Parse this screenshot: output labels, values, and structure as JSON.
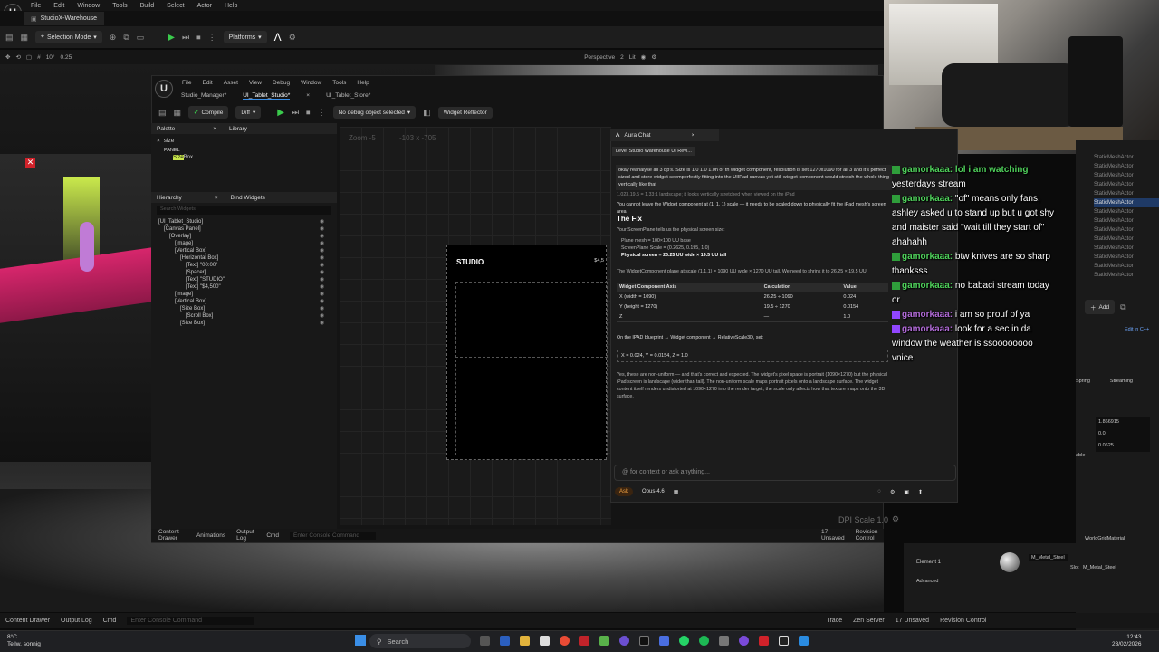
{
  "outer": {
    "menu": [
      "File",
      "Edit",
      "Window",
      "Tools",
      "Build",
      "Select",
      "Actor",
      "Help"
    ],
    "project_tab": "StudioX-Warehouse",
    "selection_mode": "Selection Mode",
    "platforms": "Platforms",
    "viewport_options": {
      "perspective": "Perspective",
      "lit": "Lit",
      "rot": "10°",
      "scale": "0.25",
      "cam": "2"
    },
    "outliner_items": [
      "StaticMeshActor",
      "StaticMeshActor",
      "StaticMeshActor",
      "StaticMeshActor",
      "StaticMeshActor",
      "StaticMeshActor",
      "StaticMeshActor",
      "StaticMeshActor",
      "StaticMeshActor",
      "StaticMeshActor",
      "StaticMeshActor",
      "StaticMeshActor",
      "StaticMeshActor",
      "StaticMeshActor"
    ],
    "details": {
      "add": "Add",
      "edit_cpp": "Edit in C++",
      "spring": "Spring",
      "streaming": "Streaming",
      "v1": "1.866915",
      "v2": "0.0",
      "v3": "0.0625",
      "table": "able"
    },
    "material_slot": {
      "element": "Element 1",
      "material": "M_Metal_Steel",
      "slot_label": "Slot",
      "slot_value": "M_Metal_Steel",
      "advanced": "Advanced",
      "world_grid": "WorldGridMaterial"
    },
    "bottom": {
      "content_drawer": "Content Drawer",
      "output_log": "Output Log",
      "cmd": "Cmd",
      "console": "Enter Console Command",
      "trace": "Trace",
      "zen": "Zen Server",
      "unsaved": "17 Unsaved",
      "revision": "Revision Control"
    }
  },
  "widget_editor": {
    "menu": [
      "File",
      "Edit",
      "Asset",
      "View",
      "Debug",
      "Window",
      "Tools",
      "Help"
    ],
    "tabs": [
      "Studio_Manager*",
      "UI_Tablet_Studio*",
      "UI_Tablet_Store*"
    ],
    "toolbar": {
      "compile": "Compile",
      "diff": "Diff",
      "debug_select": "No debug object selected",
      "reflector": "Widget Reflector"
    },
    "palette": {
      "tab": "Palette",
      "library": "Library",
      "search": "size",
      "category": "PANEL",
      "item_highlight": "Size",
      "item_rest": " Box"
    },
    "hierarchy": {
      "tab": "Hierarchy",
      "bind": "Bind Widgets",
      "search_placeholder": "Search Widgets",
      "items": [
        "[UI_Tablet_Studio]",
        "[Canvas Panel]",
        "[Overlay]",
        "[Image]",
        "[Vertical Box]",
        "[Horizontal Box]",
        "[Text] \"00:00\"",
        "[Spacer]",
        "[Text] \"STUDIO\"",
        "[Text] \"$4,500\"",
        "[Image]",
        "[Vertical Box]",
        "[Size Box]",
        "[Scroll Box]",
        "[Size Box]"
      ]
    },
    "designer": {
      "zoom": "Zoom -5",
      "coords": "-103 x -705",
      "studio_label": "STUDIO",
      "price": "$4,5",
      "dpi": "DPI Scale 1.0"
    },
    "bottom": {
      "content_drawer": "Content Drawer",
      "animations": "Animations",
      "output_log": "Output Log",
      "cmd": "Cmd",
      "console": "Enter Console Command",
      "unsaved": "17 Unsaved",
      "revision": "Revision Control"
    }
  },
  "chat": {
    "tab": "Aura Chat",
    "crumb": "Level Studio Warehouse UI Revi...",
    "user_msg": "okay reanalyse all 3 bp's. Size is 1.0 1.0 1.0n or th widget component, resolution is set 1270x1090 for all 3 and it's perfect sized and store widget seemperfectly fitting into the UIIPad canvas yet still widget component would stretch the whole thing vertically like that",
    "pre": "1.023.19.5 = 1.33:1 landscape; it looks vertically stretched when viewed on the iPad",
    "cannot": "You cannot leave the Widget component at (1, 1, 1) scale — it needs to be scaled down to physically fit the iPad mesh's screen area.",
    "fix_heading": "The Fix",
    "screenplane_intro": "Your ScreenPlane tells us the physical screen size:",
    "bullets": [
      "Plane mesh = 100×100 UU base",
      "ScreenPlane Scale = (0.2625, 0.195, 1.0)",
      "Physical screen = 26.25 UU wide × 19.5 UU tall"
    ],
    "widget_plane": "The WidgetComponent plane at scale (1,1,1) = 1090 UU wide × 1270 UU tall. We need to shrink it to 26.25 × 19.5 UU.",
    "table": {
      "headers": [
        "Widget Component Axis",
        "Calculation",
        "Value"
      ],
      "rows": [
        [
          "X (width = 1090)",
          "26.25 ÷ 1090",
          "0.024"
        ],
        [
          "Y (height = 1270)",
          "19.5 ÷ 1270",
          "0.0154"
        ],
        [
          "Z",
          "—",
          "1.0"
        ]
      ]
    },
    "apply": "On the IPAD blueprint → Widget component → RelativeScale3D, set:",
    "code": "X = 0.024, Y = 0.0154, Z = 1.0",
    "explanation": "Yes, these are non-uniform — and that's correct and expected. The widget's pixel space is portrait (1090×1270) but the physical iPad screen is landscape (wider than tall). The non-uniform scale maps portrait pixels onto a landscape surface. The widget content itself renders undistorted at 1090×1270 into the render target; the scale only affects how that texture maps onto the 3D surface.",
    "input_placeholder": "@ for context or ask anything...",
    "mode": "Ask",
    "model": "Opus-4.6"
  },
  "stream_chat": [
    {
      "name": "",
      "text": "yesterdays stream",
      "pre": "gamorkaaa: lol i am watching"
    },
    {
      "name": "gamorkaaa:",
      "text": "\"of\" means only fans, ashley asked u to stand up but u got shy and maister said \"wait till they start of\" ahahahh"
    },
    {
      "name": "gamorkaaa:",
      "text": "btw knives are so sharp thanksss"
    },
    {
      "name": "gamorkaaa:",
      "text": "no babaci stream today or"
    },
    {
      "name": "gamorkaaa:",
      "text": "i am so prouf of ya"
    },
    {
      "name": "gamorkaaa:",
      "text": "look for a sec in da window the weather is ssoooooooo vnice"
    }
  ],
  "taskbar": {
    "search": "Search",
    "weather_temp": "8°C",
    "weather_desc": "Teilw. sonnig",
    "time": "12:43",
    "date": "23/02/2026"
  },
  "colors": {
    "accent": "#3a8ee6",
    "chat_name": "#4fd15b",
    "play": "#3aca4c",
    "pink": "#d7266c"
  }
}
